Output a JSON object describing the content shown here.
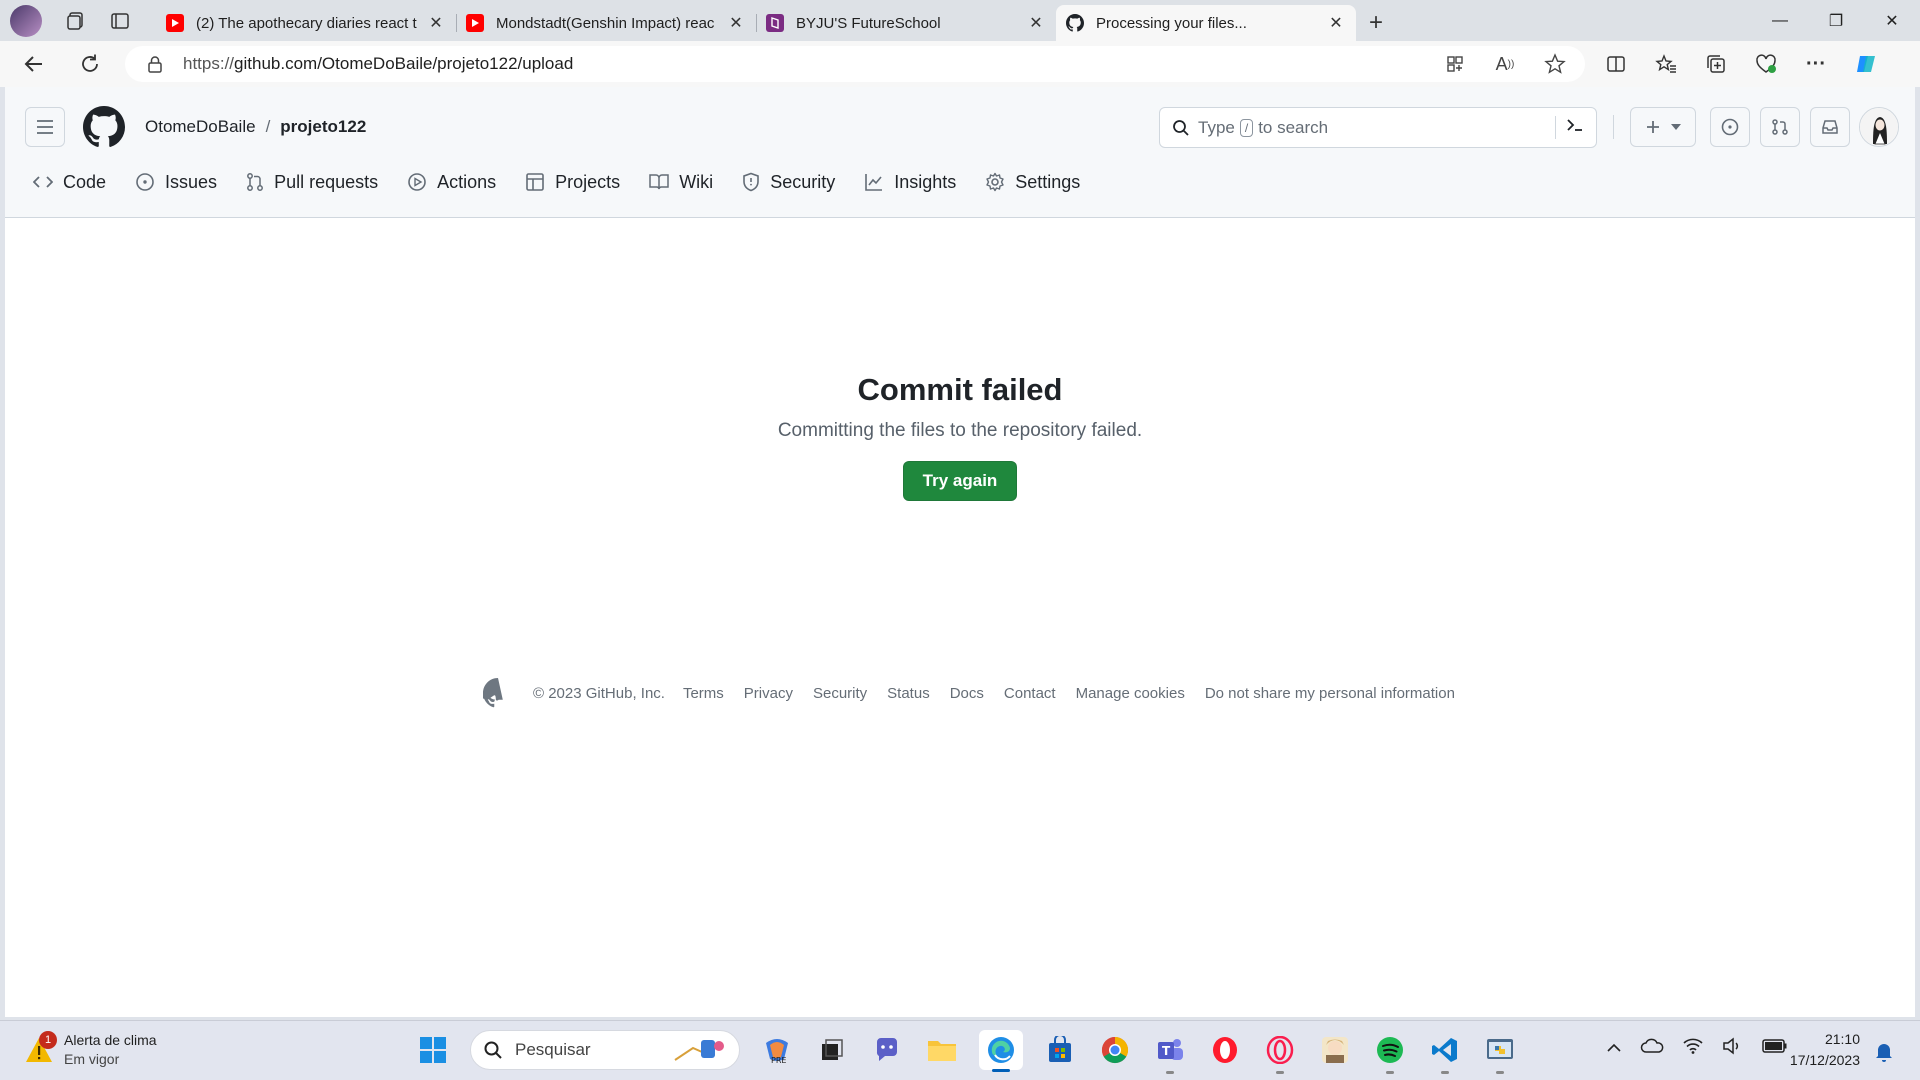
{
  "browser": {
    "tabs": [
      {
        "title": "(2) The apothecary diaries react t",
        "favicon": "youtube-icon",
        "active": false
      },
      {
        "title": "Mondstadt(Genshin Impact) reac",
        "favicon": "youtube-icon",
        "active": false
      },
      {
        "title": "BYJU'S FutureSchool",
        "favicon": "byjus-icon",
        "active": false
      },
      {
        "title": "Processing your files...",
        "favicon": "github-icon",
        "active": true
      }
    ],
    "close_glyph": "✕",
    "url_prefix": "https://",
    "url_host_path": "github.com/OtomeDoBaile/projeto122/upload"
  },
  "github": {
    "owner": "OtomeDoBaile",
    "separator": "/",
    "repo": "projeto122",
    "search": {
      "before": "Type",
      "key": "/",
      "after": "to search"
    },
    "nav": [
      {
        "label": "Code",
        "icon": "code-icon"
      },
      {
        "label": "Issues",
        "icon": "issue-icon"
      },
      {
        "label": "Pull requests",
        "icon": "pull-request-icon"
      },
      {
        "label": "Actions",
        "icon": "play-icon"
      },
      {
        "label": "Projects",
        "icon": "table-icon"
      },
      {
        "label": "Wiki",
        "icon": "book-icon"
      },
      {
        "label": "Security",
        "icon": "shield-icon"
      },
      {
        "label": "Insights",
        "icon": "graph-icon"
      },
      {
        "label": "Settings",
        "icon": "gear-icon"
      }
    ]
  },
  "main": {
    "title": "Commit failed",
    "message": "Committing the files to the repository failed.",
    "retry_label": "Try again",
    "retry_color": "#1f883d"
  },
  "footer": {
    "copyright": "© 2023 GitHub, Inc.",
    "links": [
      "Terms",
      "Privacy",
      "Security",
      "Status",
      "Docs",
      "Contact",
      "Manage cookies",
      "Do not share my personal information"
    ]
  },
  "taskbar": {
    "weather_title": "Alerta de clima",
    "weather_sub": "Em vigor",
    "weather_badge": "1",
    "search_placeholder": "Pesquisar",
    "time": "21:10",
    "date": "17/12/2023"
  }
}
